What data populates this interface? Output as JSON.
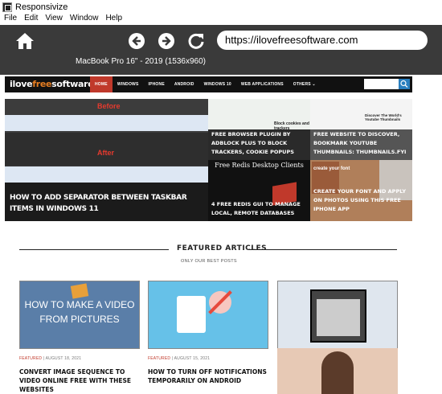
{
  "window": {
    "title": "Responsivize"
  },
  "menu": [
    "File",
    "Edit",
    "View",
    "Window",
    "Help"
  ],
  "toolbar": {
    "url": "https://ilovefreesoftware.com",
    "device": "MacBook Pro 16\" - 2019 (1536x960)"
  },
  "site": {
    "logo_main": "ilove",
    "logo_free": "free",
    "logo_tail": "software",
    "nav": [
      "HOME",
      "WINDOWS",
      "IPHONE",
      "ANDROID",
      "WINDOWS 10",
      "WEB APPLICATIONS",
      "OTHERS ⌄"
    ]
  },
  "hero": {
    "before_label": "Before",
    "after_label": "After",
    "title": "HOW TO ADD SEPARATOR BETWEEN TASKBAR ITEMS IN WINDOWS 11"
  },
  "tiles": [
    {
      "title": "FREE BROWSER PLUGIN BY ADBLOCK PLUS TO BLOCK TRACKERS, COOKIE POPUPS",
      "img_text": "Block cookies and trackers"
    },
    {
      "title": "FREE WEBSITE TO DISCOVER, BOOKMARK YOUTUBE THUMBNAILS: THUMBNAILS.FYI",
      "img_text": "Discover The World's Youtube Thumbnails"
    },
    {
      "title": "4 FREE REDIS GUI TO MANAGE LOCAL, REMOTE DATABASES",
      "img_text": "Free Redis Desktop Clients"
    },
    {
      "title": "CREATE YOUR FONT AND APPLY ON PHOTOS USING THIS FREE IPHONE APP",
      "img_text": "create your font"
    }
  ],
  "featured": {
    "heading": "FEATURED ARTICLES",
    "sub": "ONLY OUR BEST POSTS",
    "cards": [
      {
        "img_text": "HOW TO MAKE A VIDEO FROM PICTURES",
        "category": "FEATURED",
        "date": "AUGUST 18, 2021",
        "title": "CONVERT IMAGE SEQUENCE TO VIDEO ONLINE FREE WITH THESE WEBSITES"
      },
      {
        "category": "FEATURED",
        "date": "AUGUST 15, 2021",
        "title": "HOW TO TURN OFF NOTIFICATIONS TEMPORARILY ON ANDROID"
      }
    ]
  },
  "colors": {
    "toolbar": "#3a3a3a",
    "accent": "#c0392b",
    "nav_bg": "#111111"
  }
}
